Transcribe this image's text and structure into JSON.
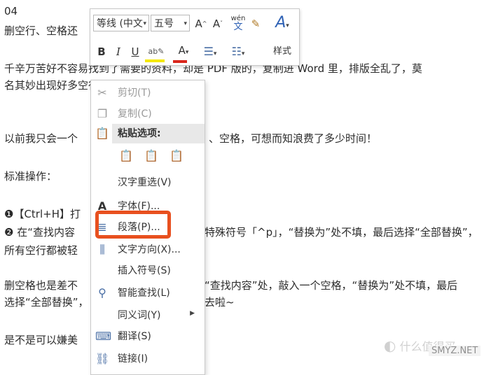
{
  "document": {
    "lines": [
      "04",
      "删空行、空格还",
      "千辛万苦好不容易找到了需要的资料，却是 PDF 版的，复制进 Word 里，排版全乱了，莫",
      "名其妙出现好多空行、空格",
      "以前我只会一个",
      "、空格，可想而知浪费了多少时间！",
      "标准操作：",
      "❶【Ctrl+H】打",
      "❷ 在“查找内容",
      "特殊符号「^p」，“替换为”处不填，最后选择“全部替换”，",
      "所有空行都被轻",
      "删空格也是差不",
      "“查找内容”处，敲入一个空格，“替换为”处不填，最后",
      "选择“全部替换”，",
      "去啦~",
      "是不是可以嫌美"
    ]
  },
  "mini_toolbar": {
    "font_name": "等线 (中文",
    "font_size": "五号",
    "grow_font": "A",
    "shrink_font": "A",
    "phonetic": "wén",
    "bold": "B",
    "italic": "I",
    "underline": "U",
    "font_color": "A",
    "styles_label": "样式"
  },
  "context_menu": {
    "items": [
      {
        "label": "剪切(T)",
        "icon": "scissors-icon",
        "enabled": false
      },
      {
        "label": "复制(C)",
        "icon": "copy-icon",
        "enabled": false
      },
      {
        "label": "粘贴选项:",
        "icon": "clipboard-icon",
        "enabled": true
      },
      {
        "label": "汉字重选(V)",
        "icon": "",
        "enabled": true
      },
      {
        "label": "字体(F)...",
        "icon": "font-icon",
        "enabled": true
      },
      {
        "label": "段落(P)...",
        "icon": "paragraph-icon",
        "enabled": true
      },
      {
        "label": "文字方向(X)...",
        "icon": "text-direction-icon",
        "enabled": true
      },
      {
        "label": "插入符号(S)",
        "icon": "",
        "enabled": true
      },
      {
        "label": "智能查找(L)",
        "icon": "search-icon",
        "enabled": true
      },
      {
        "label": "同义词(Y)",
        "icon": "",
        "enabled": true
      },
      {
        "label": "翻译(S)",
        "icon": "translate-icon",
        "enabled": true
      },
      {
        "label": "链接(I)",
        "icon": "link-icon",
        "enabled": true
      }
    ]
  },
  "watermark": "什么值得买",
  "watermark_site": "SMYZ.NET",
  "colors": {
    "highlight_border": "#e8501f",
    "font_color_bar": "#d9261c",
    "highlight_color_bar": "#f5e900"
  }
}
